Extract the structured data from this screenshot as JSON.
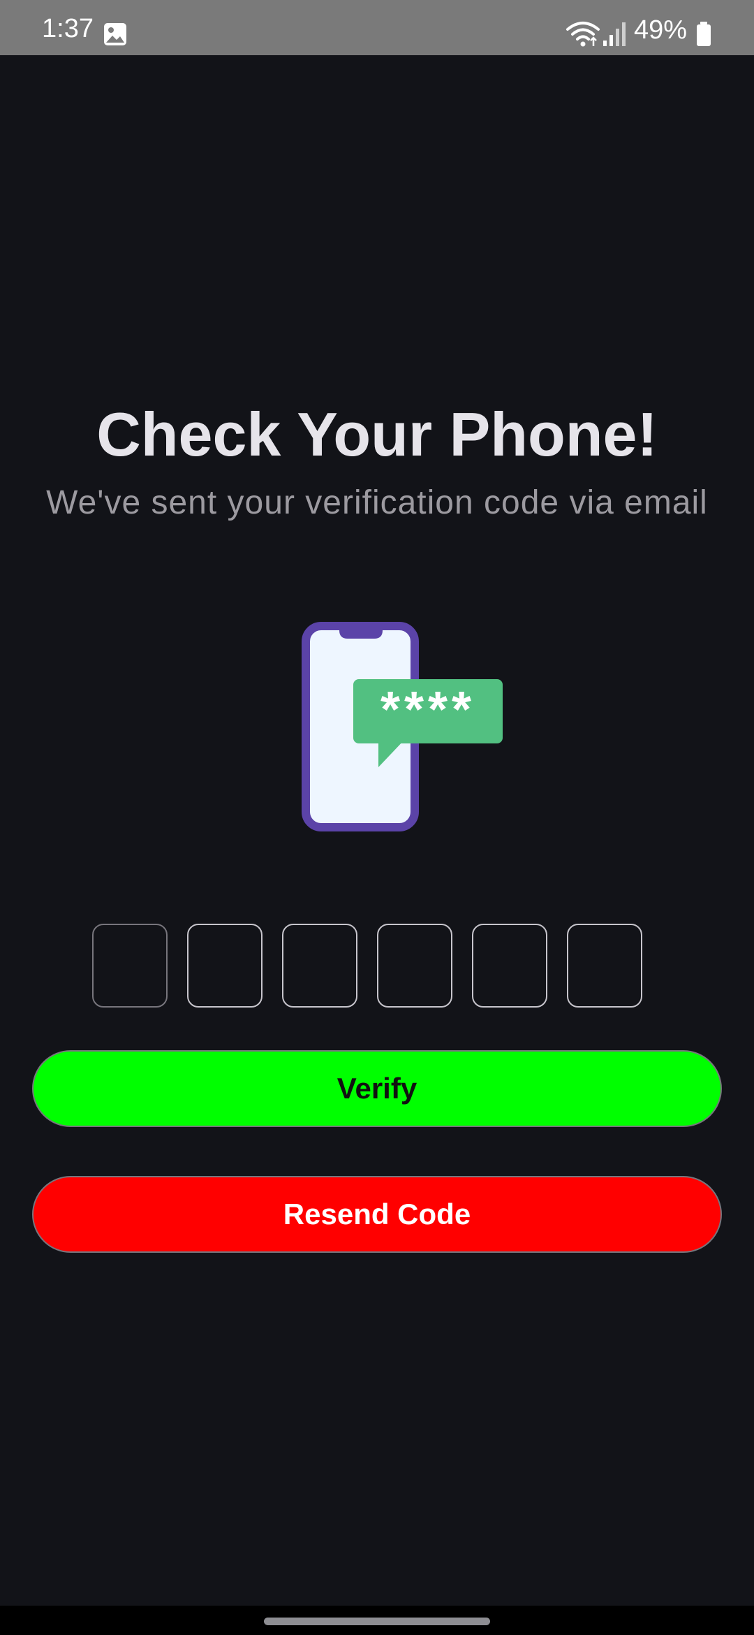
{
  "status_bar": {
    "time": "1:37",
    "battery": "49%",
    "icons": [
      "gallery-icon",
      "wifi-icon",
      "signal-icon",
      "battery-icon"
    ]
  },
  "verification": {
    "title": "Check Your Phone!",
    "subtitle": "We've sent your verification code via email",
    "illustration": {
      "name": "phone-code-illustration",
      "bubble_text": "****",
      "colors": {
        "phone_frame": "#5b43a8",
        "phone_screen": "#eef6ff",
        "bubble": "#52c081"
      }
    },
    "code_inputs": [
      "",
      "",
      "",
      "",
      "",
      ""
    ],
    "verify_label": "Verify",
    "resend_label": "Resend Code"
  },
  "colors": {
    "background": "#121318",
    "verify_button": "#00ff00",
    "resend_button": "#ff0000",
    "title_text": "#e6e4ea",
    "subtitle_text": "#9c9aa0"
  }
}
